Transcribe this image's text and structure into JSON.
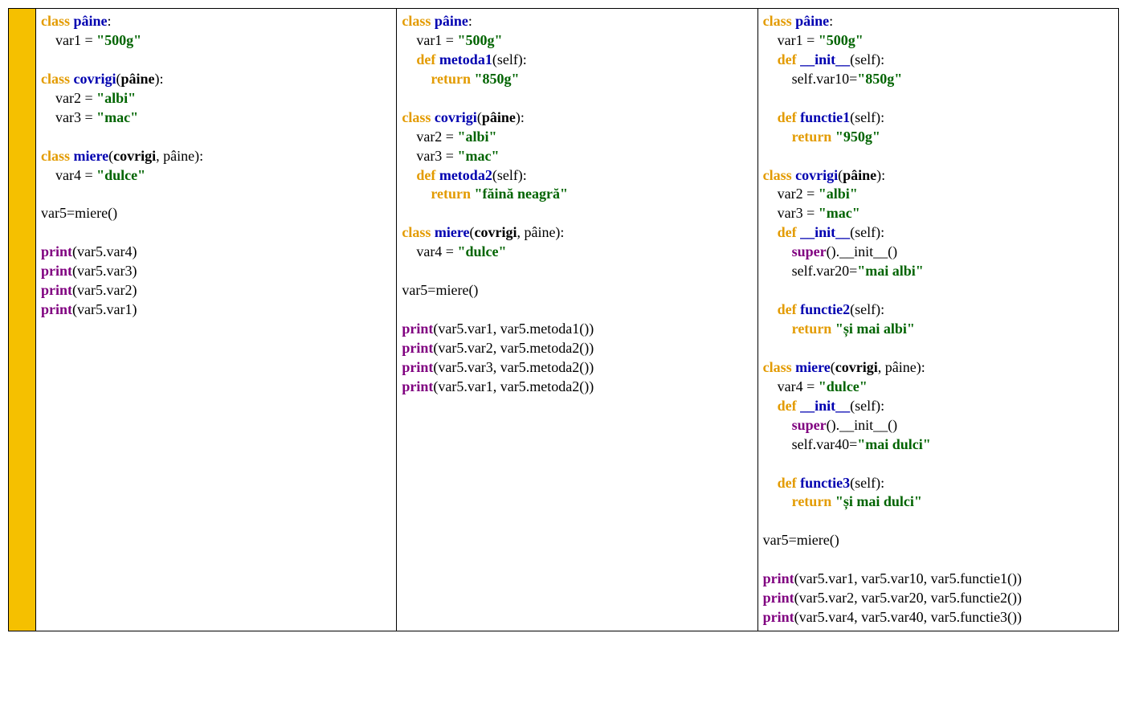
{
  "col1": {
    "class1_kw": "class",
    "class1_name": "pâine",
    "class1_colon": ":",
    "var1_lhs": "    var1 = ",
    "var1_val": "\"500g\"",
    "blank1": "",
    "class2_kw": "class",
    "class2_name": "covrigi",
    "class2_open": "(",
    "class2_parent": "pâine",
    "class2_close": "):",
    "var2_lhs": "    var2 = ",
    "var2_val": "\"albi\"",
    "var3_lhs": "    var3 = ",
    "var3_val": "\"mac\"",
    "blank2": "",
    "class3_kw": "class",
    "class3_name": "miere",
    "class3_open": "(",
    "class3_p1": "covrigi",
    "class3_sep": ", pâine):",
    "var4_lhs": "    var4 = ",
    "var4_val": "\"dulce\"",
    "blank3": "",
    "inst": "var5=miere()",
    "blank4": "",
    "p1_fn": "print",
    "p1_arg": "(var5.var4)",
    "p2_fn": "print",
    "p2_arg": "(var5.var3)",
    "p3_fn": "print",
    "p3_arg": "(var5.var2)",
    "p4_fn": "print",
    "p4_arg": "(var5.var1)"
  },
  "col2": {
    "class1_kw": "class",
    "class1_name": "pâine",
    "class1_colon": ":",
    "var1_lhs": "    var1 = ",
    "var1_val": "\"500g\"",
    "def1_indent": "    ",
    "def1_kw": "def",
    "def1_name": "metoda1",
    "def1_sig": "(self):",
    "ret1_indent": "        ",
    "ret1_kw": "return",
    "ret1_sp": " ",
    "ret1_val": "\"850g\"",
    "blank1": "",
    "class2_kw": "class",
    "class2_name": "covrigi",
    "class2_open": "(",
    "class2_parent": "pâine",
    "class2_close": "):",
    "var2_lhs": "    var2 = ",
    "var2_val": "\"albi\"",
    "var3_lhs": "    var3 = ",
    "var3_val": "\"mac\"",
    "def2_indent": "    ",
    "def2_kw": "def",
    "def2_name": "metoda2",
    "def2_sig": "(self):",
    "ret2_indent": "        ",
    "ret2_kw": "return",
    "ret2_sp": " ",
    "ret2_val": "\"făină neagră\"",
    "blank2": "",
    "class3_kw": "class",
    "class3_name": "miere",
    "class3_open": "(",
    "class3_p1": "covrigi",
    "class3_sep": ", pâine):",
    "var4_lhs": "    var4 = ",
    "var4_val": "\"dulce\"",
    "blank3": "",
    "inst": "var5=miere()",
    "blank4": "",
    "p1_fn": "print",
    "p1_arg": "(var5.var1, var5.metoda1())",
    "p2_fn": "print",
    "p2_arg": "(var5.var2, var5.metoda2())",
    "p3_fn": "print",
    "p3_arg": "(var5.var3, var5.metoda2())",
    "p4_fn": "print",
    "p4_arg": "(var5.var1, var5.metoda2())"
  },
  "col3": {
    "class1_kw": "class",
    "class1_name": "pâine",
    "class1_colon": ":",
    "var1_lhs": "    var1 = ",
    "var1_val": "\"500g\"",
    "def1_indent": "    ",
    "def1_kw": "def",
    "def1_name": "__init__",
    "def1_sig": "(self):",
    "body1_lhs": "        self.var10=",
    "body1_val": "\"850g\"",
    "blank1": "",
    "def1b_indent": "    ",
    "def1b_kw": "def",
    "def1b_name": "functie1",
    "def1b_sig": "(self):",
    "ret1b_indent": "        ",
    "ret1b_kw": "return",
    "ret1b_sp": " ",
    "ret1b_val": "\"950g\"",
    "blank2": "",
    "class2_kw": "class",
    "class2_name": "covrigi",
    "class2_open": "(",
    "class2_parent": "pâine",
    "class2_close": "):",
    "var2_lhs": "    var2 = ",
    "var2_val": "\"albi\"",
    "var3_lhs": "    var3 = ",
    "var3_val": "\"mac\"",
    "def2_indent": "    ",
    "def2_kw": "def",
    "def2_name": "__init__",
    "def2_sig": "(self):",
    "sup2_indent": "        ",
    "sup2_fn": "super",
    "sup2_rest": "().__init__()",
    "body2_lhs": "        self.var20=",
    "body2_val": "\"mai albi\"",
    "blank3": "",
    "def2b_indent": "    ",
    "def2b_kw": "def",
    "def2b_name": "functie2",
    "def2b_sig": "(self):",
    "ret2b_indent": "        ",
    "ret2b_kw": "return",
    "ret2b_sp": " ",
    "ret2b_val": "\"și mai albi\"",
    "blank4": "",
    "class3_kw": "class",
    "class3_name": "miere",
    "class3_open": "(",
    "class3_p1": "covrigi",
    "class3_sep": ", pâine):",
    "var4_lhs": "    var4 = ",
    "var4_val": "\"dulce\"",
    "def3_indent": "    ",
    "def3_kw": "def",
    "def3_name": "__init__",
    "def3_sig": "(self):",
    "sup3_indent": "        ",
    "sup3_fn": "super",
    "sup3_rest": "().__init__()",
    "body3_lhs": "        self.var40=",
    "body3_val": "\"mai dulci\"",
    "blank5": "",
    "def3b_indent": "    ",
    "def3b_kw": "def",
    "def3b_name": "functie3",
    "def3b_sig": "(self):",
    "ret3b_indent": "        ",
    "ret3b_kw": "return",
    "ret3b_sp": " ",
    "ret3b_val": "\"și mai dulci\"",
    "blank6": "",
    "inst": "var5=miere()",
    "blank7": "",
    "p1_fn": "print",
    "p1_arg": "(var5.var1, var5.var10, var5.functie1())",
    "p2_fn": "print",
    "p2_arg": "(var5.var2, var5.var20, var5.functie2())",
    "p3_fn": "print",
    "p3_arg": "(var5.var4, var5.var40, var5.functie3())"
  }
}
